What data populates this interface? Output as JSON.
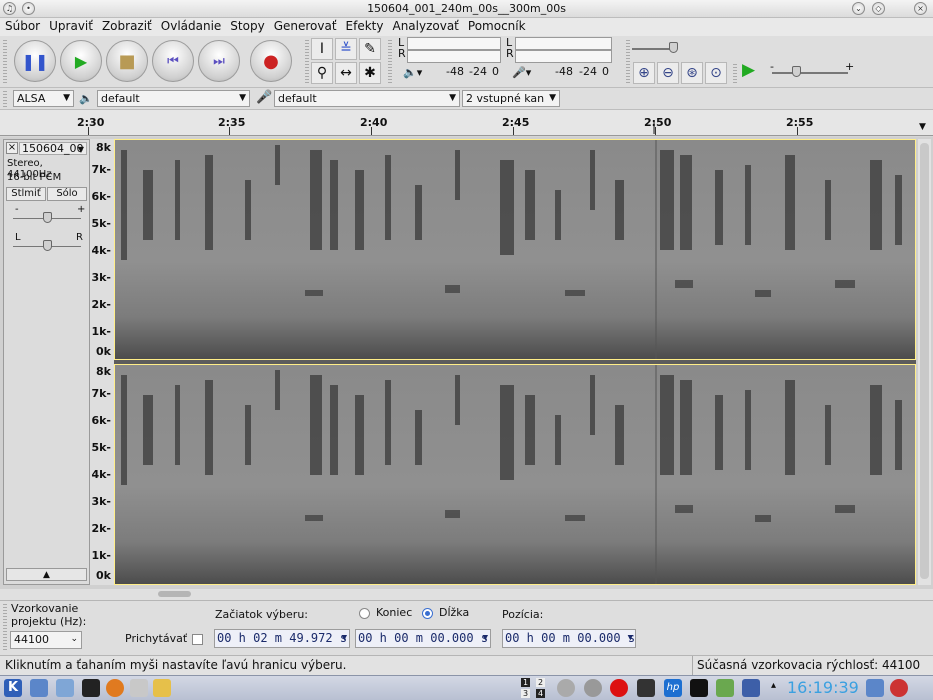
{
  "window": {
    "title": "150604_001_240m_00s__300m_00s"
  },
  "menu": [
    "Súbor",
    "Upraviť",
    "Zobraziť",
    "Ovládanie",
    "Stopy",
    "Generovať",
    "Efekty",
    "Analyzovať",
    "Pomocník"
  ],
  "meters": {
    "playback": {
      "left_label": "L",
      "right_label": "R",
      "scale": [
        "-48",
        "-24",
        "0"
      ]
    },
    "recording": {
      "left_label": "L",
      "right_label": "R",
      "scale": [
        "-48",
        "-24",
        "0"
      ]
    }
  },
  "devices": {
    "host": "ALSA",
    "output_device": "default",
    "input_device": "default",
    "channels": "2 vstupné kan"
  },
  "timeline": {
    "labels": [
      "2:30",
      "2:35",
      "2:40",
      "2:45",
      "2:50",
      "2:55"
    ]
  },
  "track": {
    "name": "150604_00",
    "info_line1": "Stereo, 44100Hz",
    "info_line2": "16-bit PCM",
    "mute_label": "Stlmiť",
    "solo_label": "Sólo",
    "gain_minus": "-",
    "gain_plus": "+",
    "pan_left": "L",
    "pan_right": "R",
    "freq_labels": [
      "8k",
      "7k-",
      "6k-",
      "5k-",
      "4k-",
      "3k-",
      "2k-",
      "1k-",
      "0k"
    ]
  },
  "selection": {
    "rate_label_line1": "Vzorkovanie",
    "rate_label_line2": "projektu (Hz):",
    "rate_value": "44100",
    "snap_label": "Prichytávať",
    "start_label": "Začiatok výberu:",
    "end_option": "Koniec",
    "length_option": "Dĺžka",
    "position_label": "Pozícia:",
    "start_value": "00 h 02 m 49.972 s",
    "length_value": "00 h 00 m 00.000 s",
    "position_value": "00 h 00 m 00.000 s"
  },
  "status": {
    "message": "Kliknutím a ťahaním myši nastavíte ľavú hranicu výberu.",
    "rate": "Súčasná vzorkovacia rýchlosť: 44100"
  },
  "taskbar": {
    "clock": "16:19:39",
    "desktops": [
      "1",
      "2",
      "3",
      "4"
    ]
  },
  "colors": {
    "spectrogram_bg": "#7d7d7d",
    "selection_border": "#ffee88",
    "clock": "#3aa0e0",
    "play_green": "#22aa22",
    "record_red": "#cc2222",
    "pause_blue": "#3355cc"
  }
}
